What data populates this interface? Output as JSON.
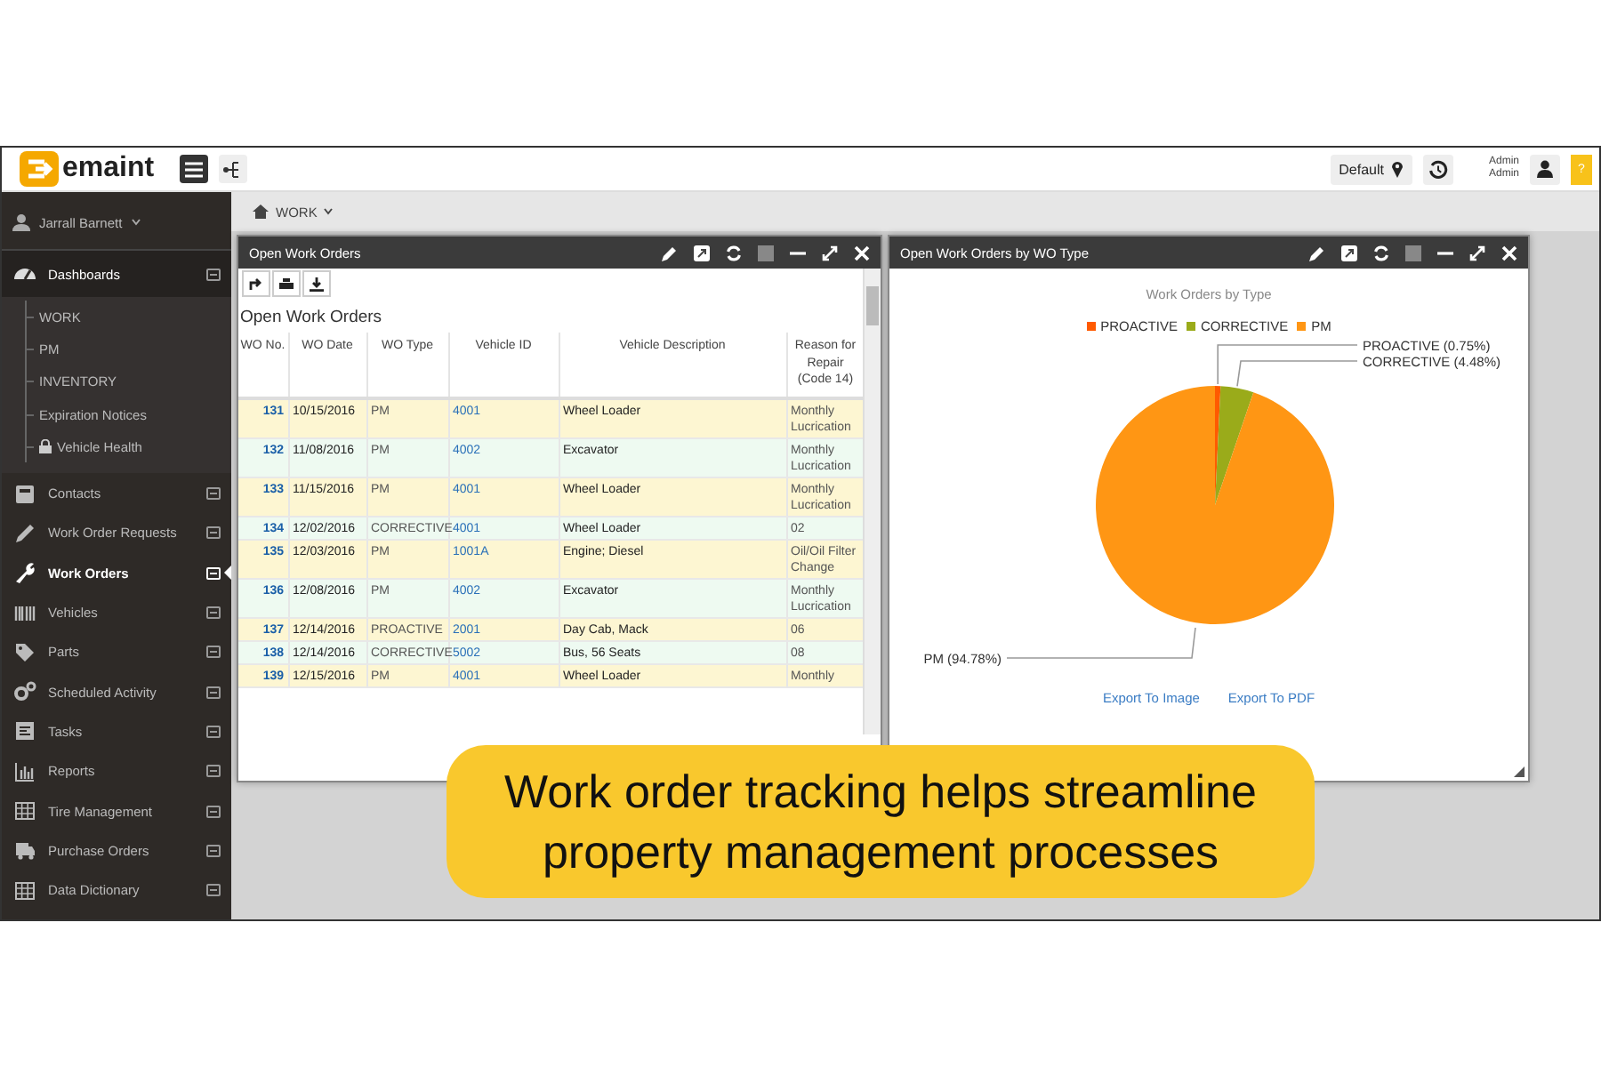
{
  "header": {
    "logo": "emaint",
    "layout_button": "Default",
    "user_lines": [
      "Admin",
      "Admin"
    ],
    "help_button": "?"
  },
  "sidebar": {
    "user": "Jarrall Barnett",
    "items": [
      {
        "label": "Dashboards",
        "selected": false,
        "children": [
          {
            "label": "WORK",
            "locked": false
          },
          {
            "label": "PM",
            "locked": false
          },
          {
            "label": "INVENTORY",
            "locked": false
          },
          {
            "label": "Expiration Notices",
            "locked": false
          },
          {
            "label": "Vehicle Health",
            "locked": true
          }
        ]
      },
      {
        "label": "Contacts",
        "selected": false
      },
      {
        "label": "Work Order Requests",
        "selected": false
      },
      {
        "label": "Work Orders",
        "selected": true
      },
      {
        "label": "Vehicles",
        "selected": false
      },
      {
        "label": "Parts",
        "selected": false
      },
      {
        "label": "Scheduled Activity",
        "selected": false
      },
      {
        "label": "Tasks",
        "selected": false
      },
      {
        "label": "Reports",
        "selected": false
      },
      {
        "label": "Tire Management",
        "selected": false
      },
      {
        "label": "Purchase Orders",
        "selected": false
      },
      {
        "label": "Data Dictionary",
        "selected": false
      }
    ]
  },
  "breadcrumb": "WORK",
  "orders_panel": {
    "title": "Open Work Orders",
    "heading": "Open Work Orders",
    "columns": [
      "WO No.",
      "WO Date",
      "WO Type",
      "Vehicle ID",
      "Vehicle Description",
      "Reason for Repair (Code 14)"
    ],
    "rows": [
      {
        "no": "131",
        "date": "10/15/2016",
        "type": "PM",
        "vehicle_id": "4001",
        "description": "Wheel Loader",
        "reason": "Monthly Lucrication"
      },
      {
        "no": "132",
        "date": "11/08/2016",
        "type": "PM",
        "vehicle_id": "4002",
        "description": "Excavator",
        "reason": "Monthly Lucrication"
      },
      {
        "no": "133",
        "date": "11/15/2016",
        "type": "PM",
        "vehicle_id": "4001",
        "description": "Wheel Loader",
        "reason": "Monthly Lucrication"
      },
      {
        "no": "134",
        "date": "12/02/2016",
        "type": "CORRECTIVE",
        "vehicle_id": "4001",
        "description": "Wheel Loader",
        "reason": "02"
      },
      {
        "no": "135",
        "date": "12/03/2016",
        "type": "PM",
        "vehicle_id": "1001A",
        "description": "Engine; Diesel",
        "reason": "Oil/Oil Filter Change"
      },
      {
        "no": "136",
        "date": "12/08/2016",
        "type": "PM",
        "vehicle_id": "4002",
        "description": "Excavator",
        "reason": "Monthly Lucrication"
      },
      {
        "no": "137",
        "date": "12/14/2016",
        "type": "PROACTIVE",
        "vehicle_id": "2001",
        "description": "Day Cab, Mack",
        "reason": "06"
      },
      {
        "no": "138",
        "date": "12/14/2016",
        "type": "CORRECTIVE",
        "vehicle_id": "5002",
        "description": "Bus, 56 Seats",
        "reason": "08"
      },
      {
        "no": "139",
        "date": "12/15/2016",
        "type": "PM",
        "vehicle_id": "4001",
        "description": "Wheel Loader",
        "reason": "Monthly"
      }
    ]
  },
  "chart_panel": {
    "title": "Open Work Orders by WO Type",
    "links": [
      "Export To Image",
      "Export To PDF"
    ],
    "chart_data": {
      "type": "pie",
      "title": "Work Orders by Type",
      "categories": [
        "PROACTIVE",
        "CORRECTIVE",
        "PM"
      ],
      "values": [
        0.75,
        4.48,
        94.78
      ],
      "colors": [
        "#ff5a00",
        "#9aab1a",
        "#ff9614"
      ],
      "legend": "top",
      "value_labels": [
        "PROACTIVE (0.75%)",
        "CORRECTIVE (4.48%)",
        "PM (94.78%)"
      ]
    }
  },
  "caption": "Work order tracking helps streamline property management processes"
}
